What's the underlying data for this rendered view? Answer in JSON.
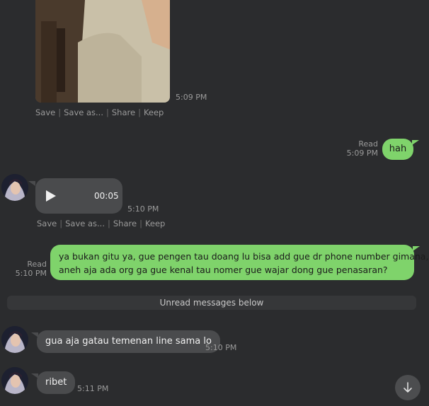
{
  "image_message": {
    "time": "5:09 PM",
    "actions": [
      "Save",
      "Save as...",
      "Share",
      "Keep"
    ]
  },
  "out_message_1": {
    "text": "hah",
    "status": "Read",
    "time": "5:09 PM"
  },
  "voice_message": {
    "duration": "00:05",
    "time": "5:10 PM",
    "actions": [
      "Save",
      "Save as...",
      "Share",
      "Keep"
    ]
  },
  "out_message_2": {
    "lines": [
      "ya bukan gitu ya, gue pengen tau doang lu bisa add gue dr phone number gimana,",
      "aneh aja ada org ga gue kenal tau nomer gue wajar dong gue penasaran?"
    ],
    "status": "Read",
    "time": "5:10 PM"
  },
  "unread_divider": "Unread messages below",
  "in_message_1": {
    "text": "gua aja gatau temenan line sama lo",
    "time": "5:10 PM"
  },
  "in_message_2": {
    "text": "ribet",
    "time": "5:11 PM"
  },
  "icons": {
    "play": "play-icon",
    "scroll_down": "arrow-down-icon"
  },
  "colors": {
    "background": "#2b2c2e",
    "outgoing_bubble": "#7fd36b",
    "incoming_bubble": "#4a4b4d"
  }
}
